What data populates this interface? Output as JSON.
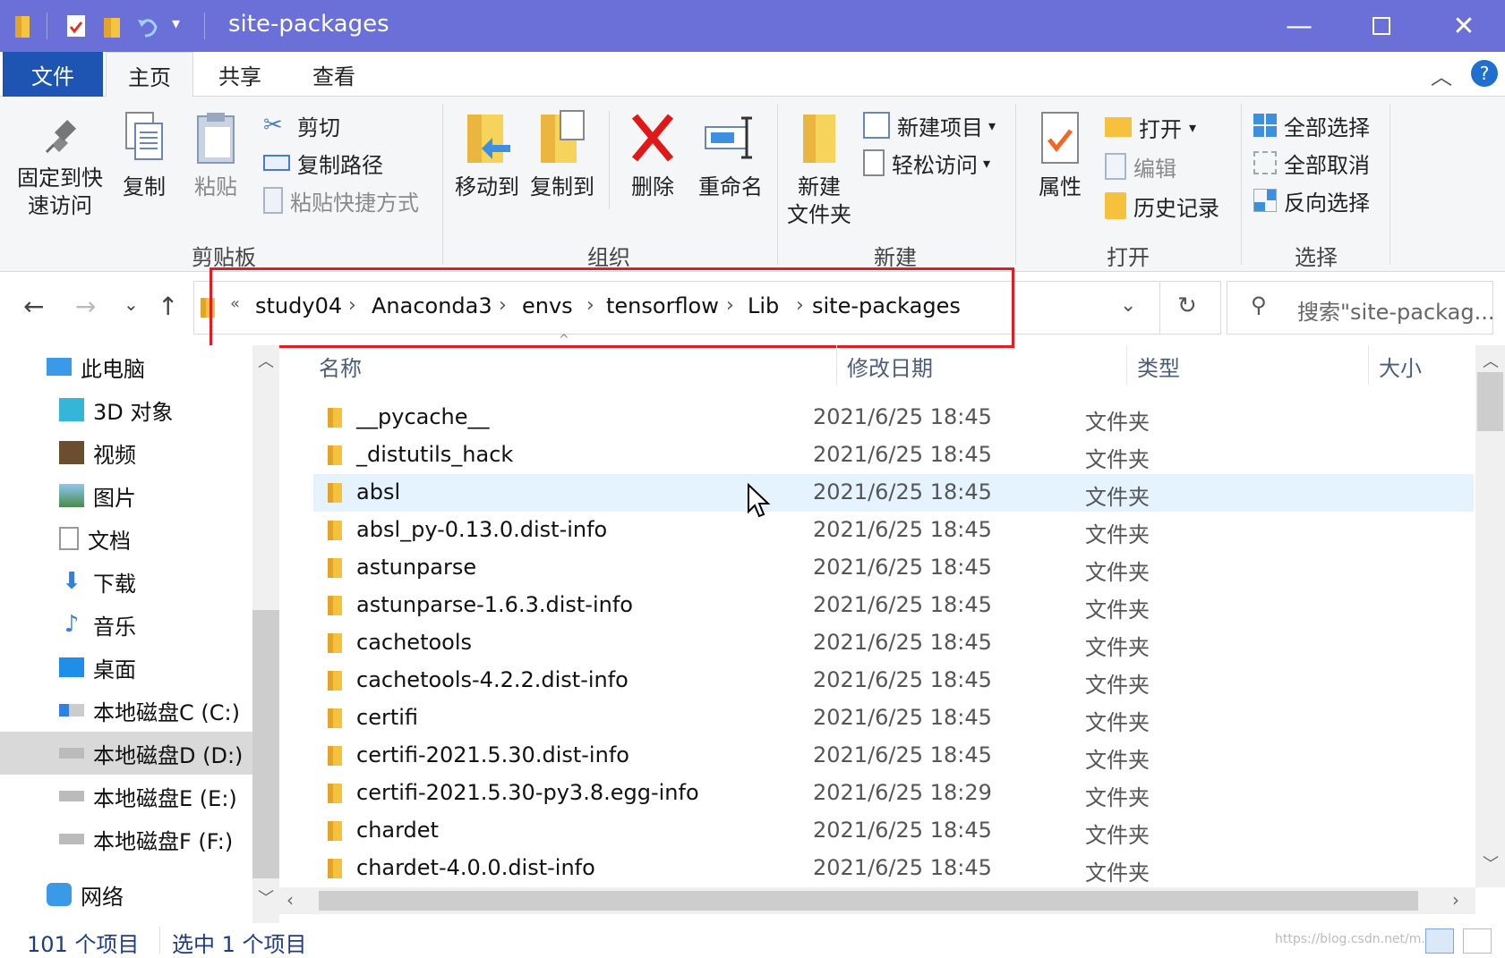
{
  "window": {
    "title": "site-packages",
    "accent": "#6b6fd8"
  },
  "tabs": [
    {
      "label": "文件"
    },
    {
      "label": "主页"
    },
    {
      "label": "共享"
    },
    {
      "label": "查看"
    }
  ],
  "ribbon": {
    "clipboard": {
      "group": "剪贴板",
      "pin": "固定到快速访问",
      "pin_l1": "固定到快",
      "pin_l2": "速访问",
      "copy": "复制",
      "paste": "粘贴",
      "cut": "剪切",
      "copy_path": "复制路径",
      "paste_shortcut": "粘贴快捷方式"
    },
    "organize": {
      "group": "组织",
      "move_to": "移动到",
      "copy_to": "复制到",
      "delete": "删除",
      "rename": "重命名"
    },
    "new": {
      "group": "新建",
      "new_folder_l1": "新建",
      "new_folder_l2": "文件夹",
      "new_item": "新建项目",
      "easy_access": "轻松访问"
    },
    "open": {
      "group": "打开",
      "properties": "属性",
      "open": "打开",
      "edit": "编辑",
      "history": "历史记录"
    },
    "select": {
      "group": "选择",
      "select_all": "全部选择",
      "select_none": "全部取消",
      "invert": "反向选择"
    }
  },
  "address": {
    "overflow": "«",
    "crumbs": [
      "study04",
      "Anaconda3",
      "envs",
      "tensorflow",
      "Lib",
      "site-packages"
    ],
    "search_placeholder": "搜索\"site-packag..."
  },
  "nav_pane": [
    {
      "label": "此电脑",
      "icon": "computer-icon"
    },
    {
      "label": "3D 对象",
      "icon": "3d-objects-icon"
    },
    {
      "label": "视频",
      "icon": "video-icon"
    },
    {
      "label": "图片",
      "icon": "pictures-icon"
    },
    {
      "label": "文档",
      "icon": "documents-icon"
    },
    {
      "label": "下载",
      "icon": "download-icon"
    },
    {
      "label": "音乐",
      "icon": "music-icon"
    },
    {
      "label": "桌面",
      "icon": "desktop-icon"
    },
    {
      "label": "本地磁盘C (C:)",
      "icon": "drive-icon"
    },
    {
      "label": "本地磁盘D (D:)",
      "icon": "drive-icon"
    },
    {
      "label": "本地磁盘E (E:)",
      "icon": "drive-icon"
    },
    {
      "label": "本地磁盘F (F:)",
      "icon": "drive-icon"
    },
    {
      "label": "网络",
      "icon": "network-icon"
    }
  ],
  "columns": {
    "name": "名称",
    "modified": "修改日期",
    "type": "类型",
    "size": "大小"
  },
  "files": [
    {
      "name": "__pycache__",
      "modified": "2021/6/25 18:45",
      "type": "文件夹"
    },
    {
      "name": "_distutils_hack",
      "modified": "2021/6/25 18:45",
      "type": "文件夹"
    },
    {
      "name": "absl",
      "modified": "2021/6/25 18:45",
      "type": "文件夹"
    },
    {
      "name": "absl_py-0.13.0.dist-info",
      "modified": "2021/6/25 18:45",
      "type": "文件夹"
    },
    {
      "name": "astunparse",
      "modified": "2021/6/25 18:45",
      "type": "文件夹"
    },
    {
      "name": "astunparse-1.6.3.dist-info",
      "modified": "2021/6/25 18:45",
      "type": "文件夹"
    },
    {
      "name": "cachetools",
      "modified": "2021/6/25 18:45",
      "type": "文件夹"
    },
    {
      "name": "cachetools-4.2.2.dist-info",
      "modified": "2021/6/25 18:45",
      "type": "文件夹"
    },
    {
      "name": "certifi",
      "modified": "2021/6/25 18:45",
      "type": "文件夹"
    },
    {
      "name": "certifi-2021.5.30.dist-info",
      "modified": "2021/6/25 18:45",
      "type": "文件夹"
    },
    {
      "name": "certifi-2021.5.30-py3.8.egg-info",
      "modified": "2021/6/25 18:29",
      "type": "文件夹"
    },
    {
      "name": "chardet",
      "modified": "2021/6/25 18:45",
      "type": "文件夹"
    },
    {
      "name": "chardet-4.0.0.dist-info",
      "modified": "2021/6/25 18:45",
      "type": "文件夹"
    }
  ],
  "status": {
    "count": "101 个项目",
    "selected": "选中 1 个项目",
    "watermark": "https://blog.csdn.net/m..."
  }
}
